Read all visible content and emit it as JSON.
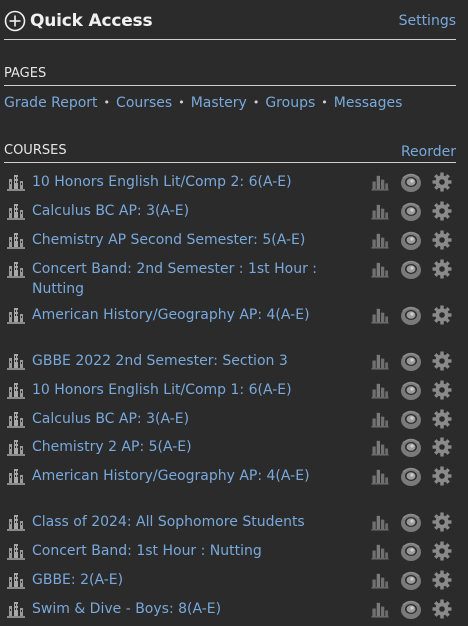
{
  "quick_access": {
    "title": "Quick Access",
    "settings_label": "Settings"
  },
  "pages": {
    "heading": "PAGES",
    "links": [
      "Grade Report",
      "Courses",
      "Mastery",
      "Groups",
      "Messages"
    ]
  },
  "courses": {
    "heading": "COURSES",
    "reorder_label": "Reorder",
    "items": [
      {
        "name": "10 Honors English Lit/Comp 2: 6(A-E)"
      },
      {
        "name": "Calculus BC AP: 3(A-E)"
      },
      {
        "name": "Chemistry AP Second Semester: 5(A-E)"
      },
      {
        "name": "Concert Band: 2nd Semester : 1st Hour : Nutting"
      },
      {
        "name": "American History/Geography AP: 4(A-E)"
      },
      {
        "name": "GBBE 2022 2nd Semester: Section 3"
      },
      {
        "name": "10 Honors English Lit/Comp 1: 6(A-E)"
      },
      {
        "name": "Calculus BC AP: 3(A-E)"
      },
      {
        "name": "Chemistry 2 AP: 5(A-E)"
      },
      {
        "name": "American History/Geography AP: 4(A-E)"
      },
      {
        "name": "Class of 2024: All Sophomore Students"
      },
      {
        "name": "Concert Band: 1st Hour : Nutting"
      },
      {
        "name": "GBBE: 2(A-E)"
      },
      {
        "name": "Swim & Dive - Boys: 8(A-E)"
      }
    ]
  },
  "colors": {
    "background": "#2b2b2b",
    "link": "#79a9dc",
    "icon_gray": "#7c7c7c"
  },
  "icons": {
    "quick_access": "plus-circle-icon",
    "course": "building-icon",
    "grades": "bar-chart-icon",
    "updates": "activity-icon",
    "course_settings": "gear-icon"
  }
}
